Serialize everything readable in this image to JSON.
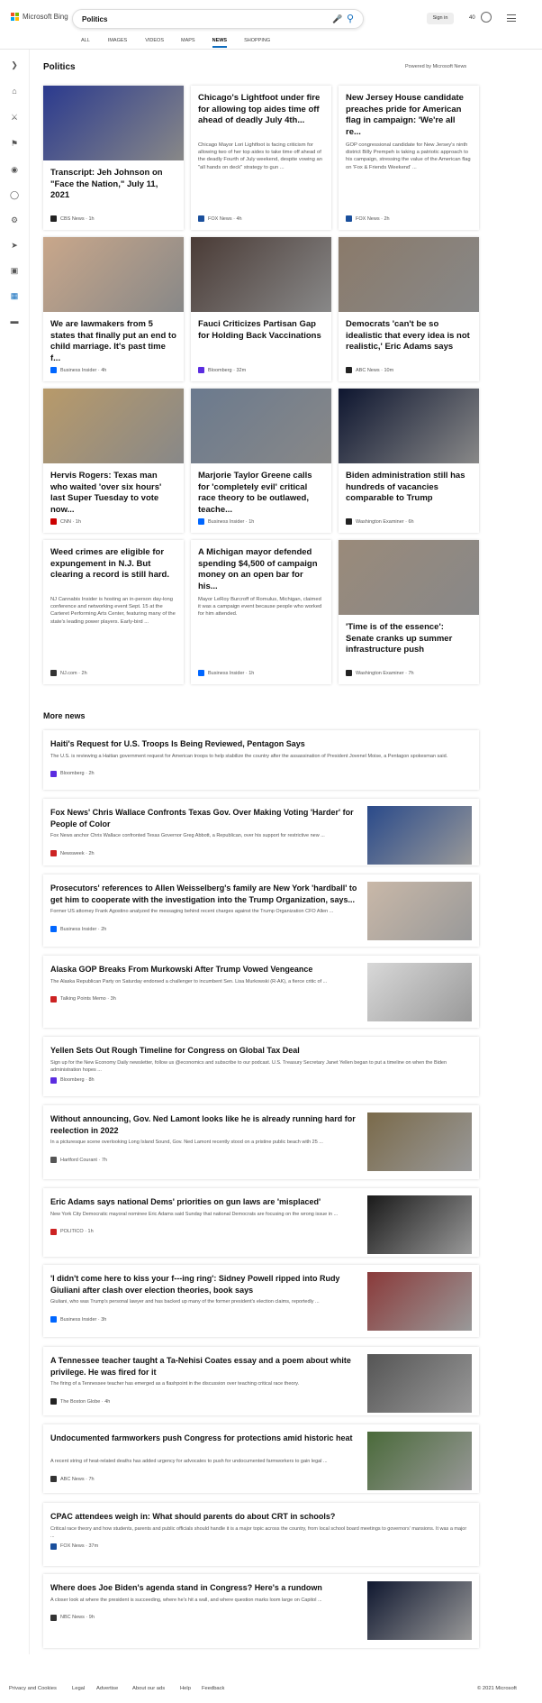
{
  "header": {
    "brand": "Microsoft Bing",
    "query": "Politics",
    "signin": "Sign in",
    "points": "40",
    "tabs": [
      "ALL",
      "IMAGES",
      "VIDEOS",
      "MAPS",
      "NEWS",
      "SHOPPING"
    ],
    "active_tab": "NEWS"
  },
  "section": {
    "title": "Politics",
    "powered": "Powered by Microsoft News"
  },
  "cards": [
    {
      "title": "Transcript: Jeh Johnson on \"Face the Nation,\" July 11, 2021",
      "body": "",
      "source": "CBS News · 1h",
      "img": "#2b3a8e"
    },
    {
      "title": "Chicago's Lightfoot under fire for allowing top aides time off ahead of deadly July 4th...",
      "body": "Chicago Mayor Lori Lightfoot is facing criticism for allowing two of her top aides to take time off ahead of the deadly Fourth of July weekend, despite vowing an \"all hands on deck\" strategy to gun ...",
      "source": "FOX News · 4h",
      "img": ""
    },
    {
      "title": "New Jersey House candidate preaches pride for American flag in campaign: 'We're all re...",
      "body": "GOP congressional candidate for New Jersey's ninth district Billy Prempeh is taking a patriotic approach to his campaign, stressing the value of the American flag on 'Fox & Friends Weekend' ...",
      "source": "FOX News · 2h",
      "img": ""
    },
    {
      "title": "We are lawmakers from 5 states that finally put an end to child marriage. It's past time f...",
      "body": "",
      "source": "Business Insider · 4h",
      "img": "#c9a78a"
    },
    {
      "title": "Fauci Criticizes Partisan Gap for Holding Back Vaccinations",
      "body": "",
      "source": "Bloomberg · 32m",
      "img": "#4a3b36"
    },
    {
      "title": "Democrats 'can't be so idealistic that every idea is not realistic,' Eric Adams says",
      "body": "",
      "source": "ABC News · 10m",
      "img": "#8a7a6a"
    },
    {
      "title": "Hervis Rogers: Texas man who waited 'over six hours' last Super Tuesday to vote now...",
      "body": "",
      "source": "CNN · 1h",
      "img": "#b89a6a"
    },
    {
      "title": "Marjorie Taylor Greene calls for 'completely evil' critical race theory to be outlawed, teache...",
      "body": "",
      "source": "Business Insider · 1h",
      "img": "#6b7a8e"
    },
    {
      "title": "Biden administration still has hundreds of vacancies comparable to Trump",
      "body": "",
      "source": "Washington Examiner · 6h",
      "img": "#0e1630"
    },
    {
      "title": "Weed crimes are eligible for expungement in N.J. But clearing a record is still hard.",
      "body": "NJ Cannabis Insider is hosting an in-person day-long conference and networking event Sept. 15 at the Carteret Performing Arts Center, featuring many of the state's leading power players. Early-bird ...",
      "source": "NJ.com · 2h",
      "img": ""
    },
    {
      "title": "A Michigan mayor defended spending $4,500 of campaign money on an open bar for his...",
      "body": "Mayor LeRoy Burcroff of Romulus, Michigan, claimed it was a campaign event because people who worked for him attended.",
      "source": "Business Insider · 1h",
      "img": ""
    },
    {
      "title": "'Time is of the essence': Senate cranks up summer infrastructure push",
      "body": "",
      "source": "Washington Examiner · 7h",
      "img": "#9a8a7a"
    }
  ],
  "more_news": {
    "title": "More news",
    "items": [
      {
        "title": "Haiti's Request for U.S. Troops Is Being Reviewed, Pentagon Says",
        "body": "The U.S. is reviewing a Haitian government request for American troops to help stabilize the country after the assassination of President Jovenel Moise, a Pentagon spokesman said.",
        "source": "Bloomberg · 2h",
        "img": ""
      },
      {
        "title": "Fox News' Chris Wallace Confronts Texas Gov. Over Making Voting 'Harder' for People of Color",
        "body": "Fox News anchor Chris Wallace confronted Texas Governor Greg Abbott, a Republican, over his support for restrictive new ...",
        "source": "Newsweek · 2h",
        "img": "#2a4a8a"
      },
      {
        "title": "Prosecutors' references to Allen Weisselberg's family are New York 'hardball' to get him to cooperate with the investigation into the Trump Organization, says...",
        "body": "Former US attorney Frank Agostino analyzed the messaging behind recent charges against the Trump Organization CFO Allen ...",
        "source": "Business Insider · 2h",
        "img": "#c9b8a8"
      },
      {
        "title": "Alaska GOP Breaks From Murkowski After Trump Vowed Vengeance",
        "body": "The Alaska Republican Party on Saturday endorsed a challenger to incumbent Sen. Lisa Murkowski (R-AK), a fierce critic of ...",
        "source": "Talking Points Memo · 3h",
        "img": "#d8d8d8"
      },
      {
        "title": "Yellen Sets Out Rough Timeline for Congress on Global Tax Deal",
        "body": "Sign up for the New Economy Daily newsletter, follow us @economics and subscribe to our podcast. U.S. Treasury Secretary Janet Yellen began to put a timeline on when the Biden administration hopes ...",
        "source": "Bloomberg · 8h",
        "img": ""
      },
      {
        "title": "Without announcing, Gov. Ned Lamont looks like he is already running hard for reelection in 2022",
        "body": "In a picturesque scene overlooking Long Island Sound, Gov. Ned Lamont recently stood on a pristine public beach with 25 ...",
        "source": "Hartford Courant · 7h",
        "img": "#7a6a4a"
      },
      {
        "title": "Eric Adams says national Dems' priorities on gun laws are 'misplaced'",
        "body": "New York City Democratic mayoral nominee Eric Adams said Sunday that national Democrats are focusing on the wrong issue in ...",
        "source": "POLITICO · 1h",
        "img": "#1a1a1a"
      },
      {
        "title": "'I didn't come here to kiss your f---ing ring': Sidney Powell ripped into Rudy Giuliani after clash over election theories, book says",
        "body": "Giuliani, who was Trump's personal lawyer and has backed up many of the former president's election claims, reportedly ...",
        "source": "Business Insider · 3h",
        "img": "#8a3a3a"
      },
      {
        "title": "A Tennessee teacher taught a Ta-Nehisi Coates essay and a poem about white privilege. He was fired for it",
        "body": "The firing of a Tennessee teacher has emerged as a flashpoint in the discussion over teaching critical race theory.",
        "source": "The Boston Globe · 4h",
        "img": "#555555"
      },
      {
        "title": "Undocumented farmworkers push Congress for protections amid historic heat",
        "body": "A recent string of heat-related deaths has added urgency for advocates to push for undocumented farmworkers to gain legal ...",
        "source": "ABC News · 7h",
        "img": "#4a6a3a"
      },
      {
        "title": "CPAC attendees weigh in: What should parents do about CRT in schools?",
        "body": "Critical race theory and how students, parents and public officials should handle it is a major topic across the country, from local school board meetings to governors' mansions. It was a major ...",
        "source": "FOX News · 37m",
        "img": ""
      },
      {
        "title": "Where does Joe Biden's agenda stand in Congress? Here's a rundown",
        "body": "A closer look at where the president is succeeding, where he's hit a wall, and where question marks loom large on Capitol ...",
        "source": "NBC News · 9h",
        "img": "#101830"
      }
    ]
  },
  "footer": {
    "links": [
      "Privacy and Cookies",
      "Legal",
      "Advertise",
      "About our ads",
      "Help",
      "Feedback"
    ],
    "copyright": "© 2021 Microsoft"
  }
}
